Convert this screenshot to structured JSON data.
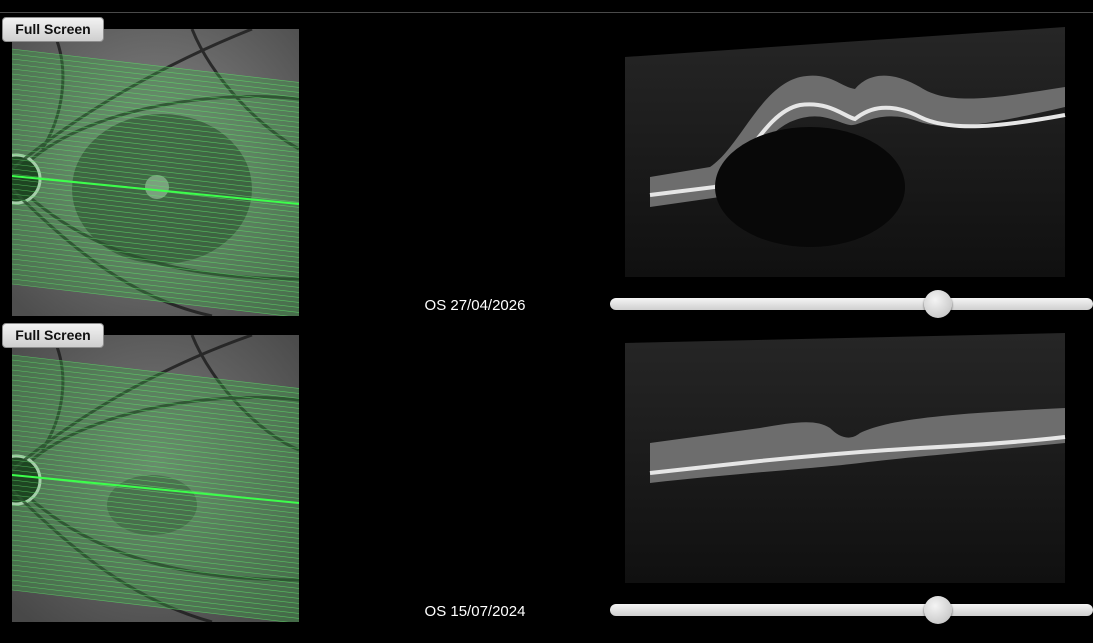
{
  "scans": [
    {
      "full_screen_label": "Full Screen",
      "visit_label": "OS 27/04/2026",
      "slice_position": 0.68,
      "raster_color": "#5fe36a",
      "active_line_color": "#3cff4b"
    },
    {
      "full_screen_label": "Full Screen",
      "visit_label": "OS 15/07/2024",
      "slice_position": 0.68,
      "raster_color": "#5fe36a",
      "active_line_color": "#3cff4b"
    }
  ]
}
